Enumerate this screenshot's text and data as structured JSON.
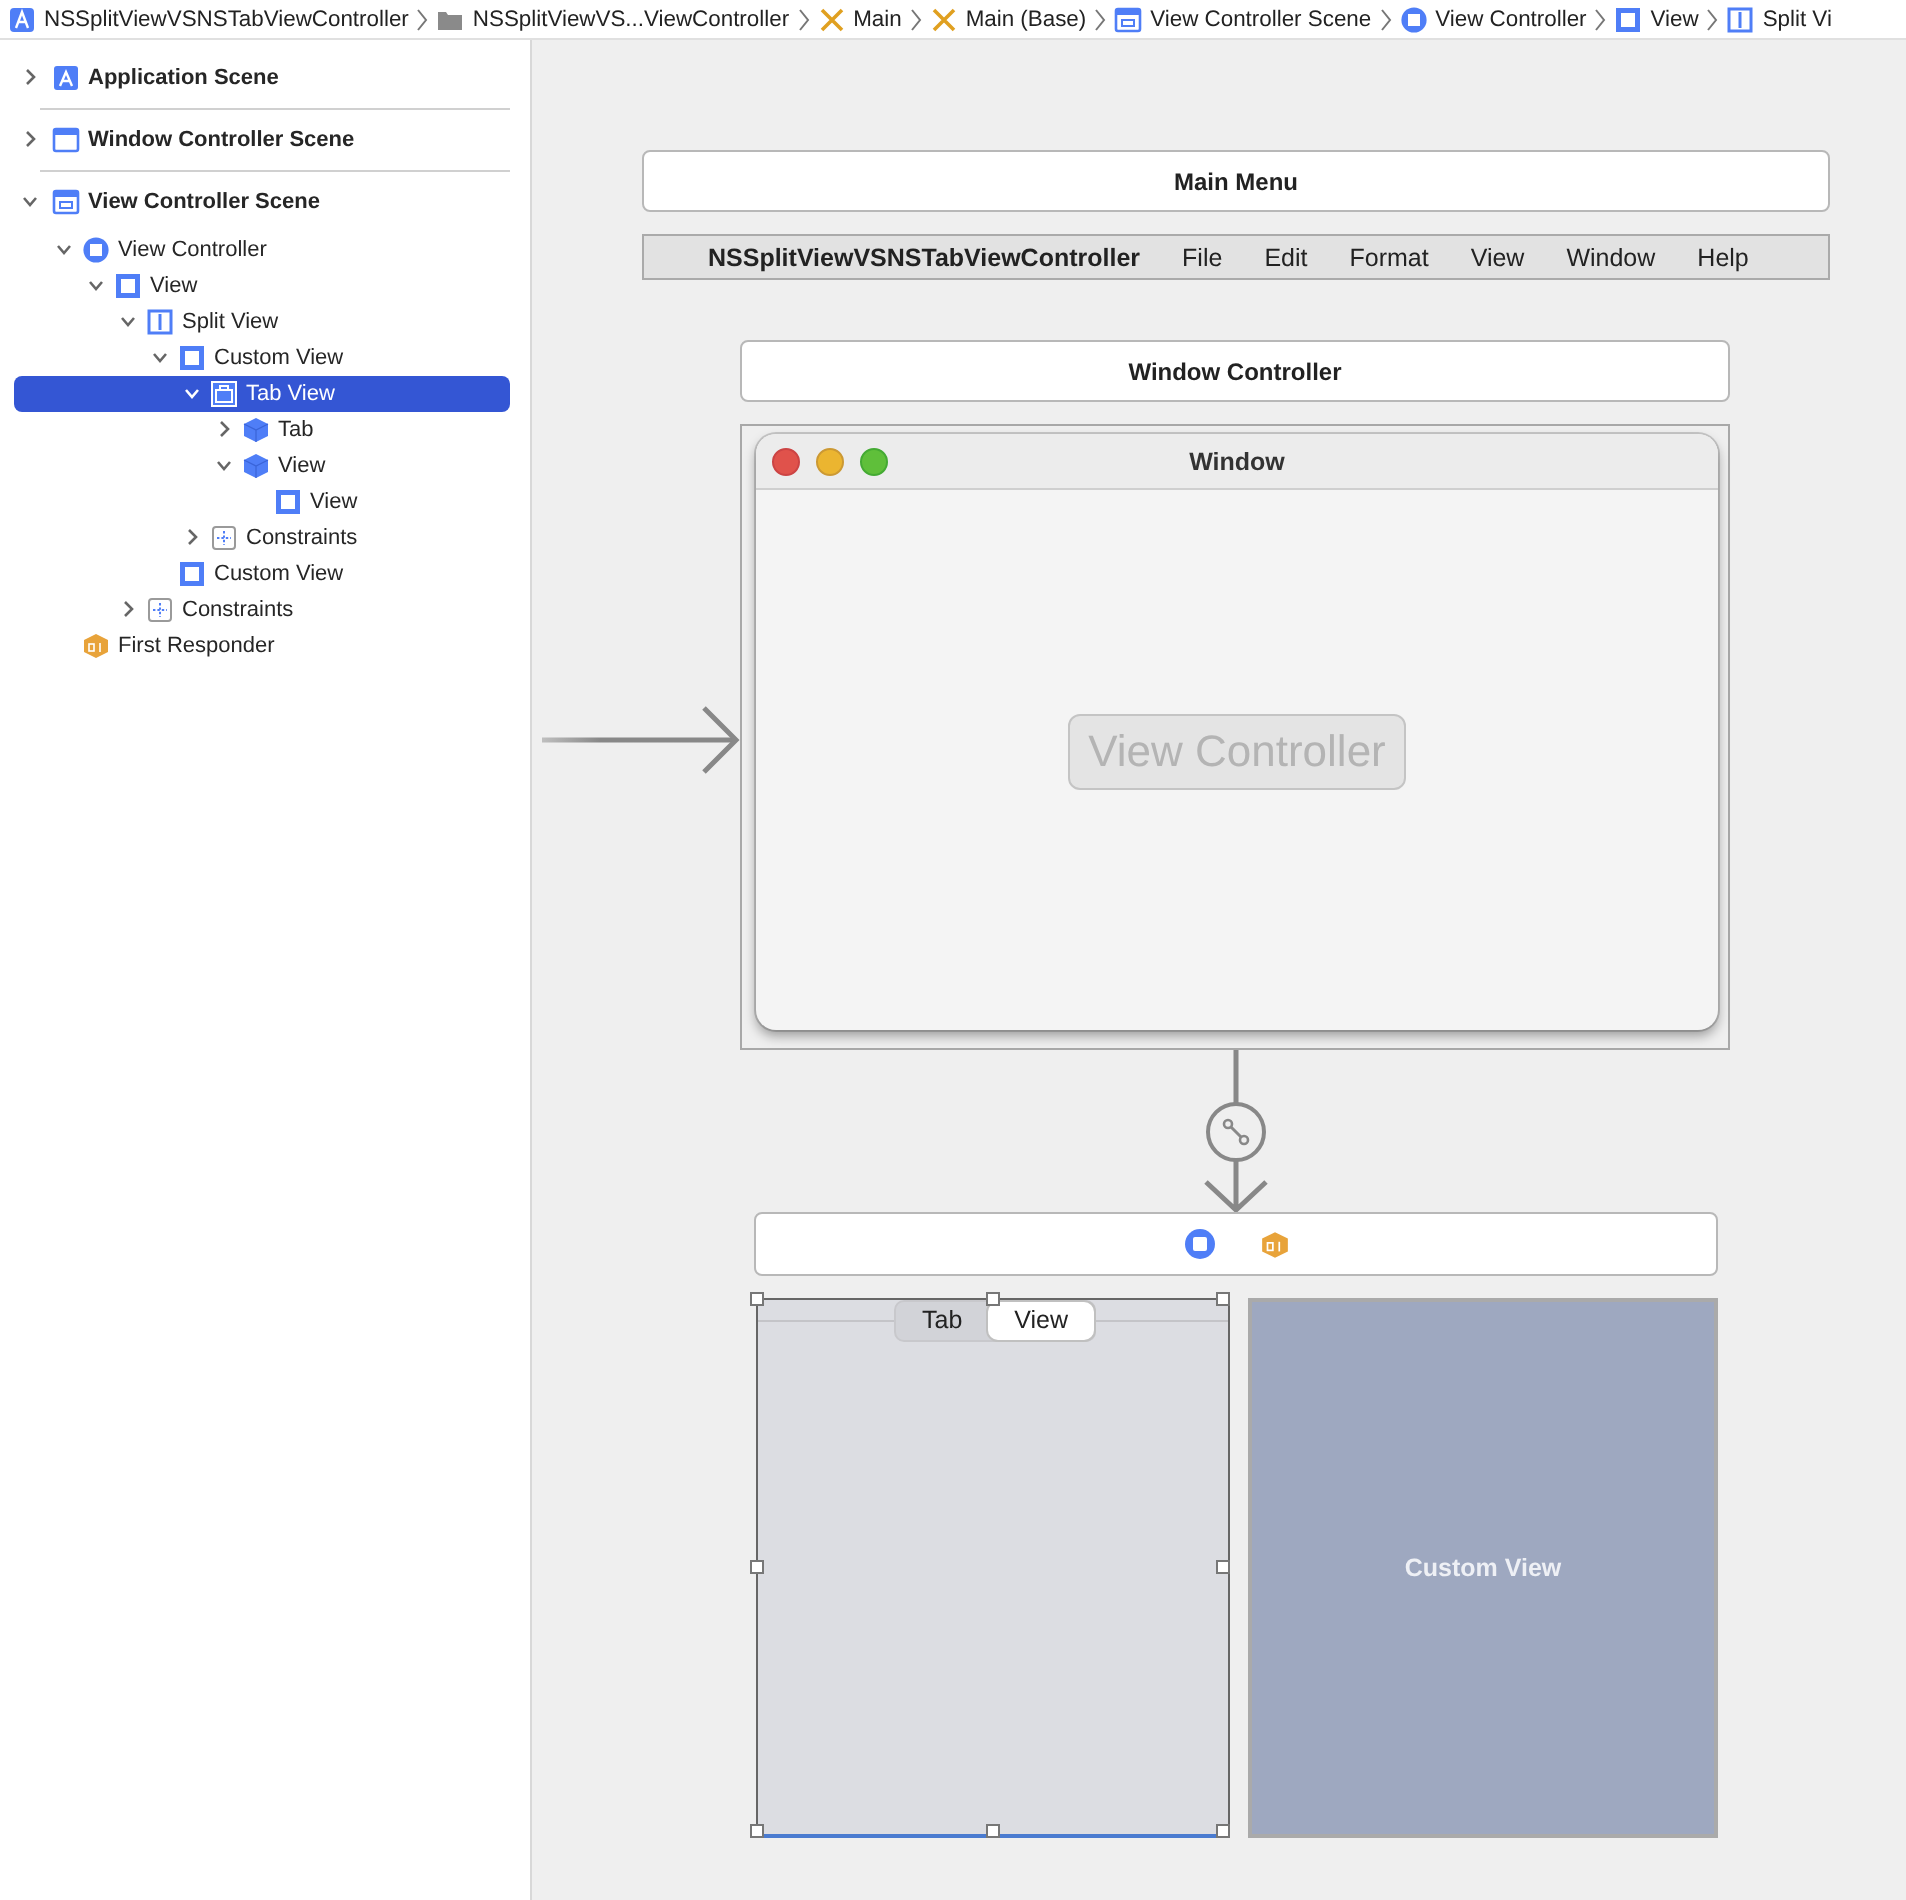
{
  "breadcrumbs": [
    {
      "label": "NSSplitViewVSNSTabViewController",
      "kind": "project"
    },
    {
      "label": "NSSplitViewVS...ViewController",
      "kind": "folder"
    },
    {
      "label": "Main",
      "kind": "storyboard"
    },
    {
      "label": "Main (Base)",
      "kind": "storyboard"
    },
    {
      "label": "View Controller Scene",
      "kind": "scene"
    },
    {
      "label": "View Controller",
      "kind": "vc"
    },
    {
      "label": "View",
      "kind": "view"
    },
    {
      "label": "Split Vi",
      "kind": "split"
    }
  ],
  "outline": {
    "scenes": [
      {
        "label": "Application Scene",
        "kind": "app",
        "expanded": false,
        "selected": false
      },
      {
        "label": "Window Controller Scene",
        "kind": "window",
        "expanded": false,
        "selected": false
      },
      {
        "label": "View Controller Scene",
        "kind": "scene",
        "expanded": true,
        "selected": false,
        "children": [
          {
            "label": "View Controller",
            "kind": "vc",
            "expanded": true,
            "selected": false,
            "children": [
              {
                "label": "View",
                "kind": "view",
                "expanded": true,
                "selected": false,
                "children": [
                  {
                    "label": "Split View",
                    "kind": "split",
                    "expanded": true,
                    "selected": false,
                    "children": [
                      {
                        "label": "Custom View",
                        "kind": "view",
                        "expanded": true,
                        "selected": false,
                        "children": [
                          {
                            "label": "Tab View",
                            "kind": "tab",
                            "expanded": true,
                            "selected": true,
                            "children": [
                              {
                                "label": "Tab",
                                "kind": "cube",
                                "expanded": false,
                                "selected": false
                              },
                              {
                                "label": "View",
                                "kind": "cube",
                                "expanded": true,
                                "selected": false,
                                "children": [
                                  {
                                    "label": "View",
                                    "kind": "view",
                                    "selected": false
                                  }
                                ]
                              }
                            ]
                          },
                          {
                            "label": "Constraints",
                            "kind": "constraints",
                            "expanded": false,
                            "selected": false
                          }
                        ]
                      },
                      {
                        "label": "Custom View",
                        "kind": "view",
                        "selected": false
                      }
                    ]
                  },
                  {
                    "label": "Constraints",
                    "kind": "constraints",
                    "expanded": false,
                    "selected": false
                  }
                ]
              }
            ]
          },
          {
            "label": "First Responder",
            "kind": "responder",
            "selected": false
          }
        ]
      }
    ]
  },
  "canvas": {
    "main_menu": {
      "title": "Main Menu",
      "menu_bar": [
        {
          "label": "NSSplitViewVSNSTabViewController",
          "kind": "app"
        },
        {
          "label": "File",
          "kind": "menu"
        },
        {
          "label": "Edit",
          "kind": "menu"
        },
        {
          "label": "Format",
          "kind": "menu"
        },
        {
          "label": "View",
          "kind": "menu"
        },
        {
          "label": "Window",
          "kind": "menu"
        },
        {
          "label": "Help",
          "kind": "menu"
        }
      ]
    },
    "window_controller": {
      "title": "Window Controller",
      "window": {
        "title": "Window",
        "content_button": "View Controller"
      }
    },
    "view_controller_scene": {
      "tab_view": {
        "tabs": [
          {
            "label": "Tab",
            "selected": false
          },
          {
            "label": "View",
            "selected": true
          }
        ]
      },
      "custom_view": {
        "label": "Custom View"
      }
    }
  }
}
